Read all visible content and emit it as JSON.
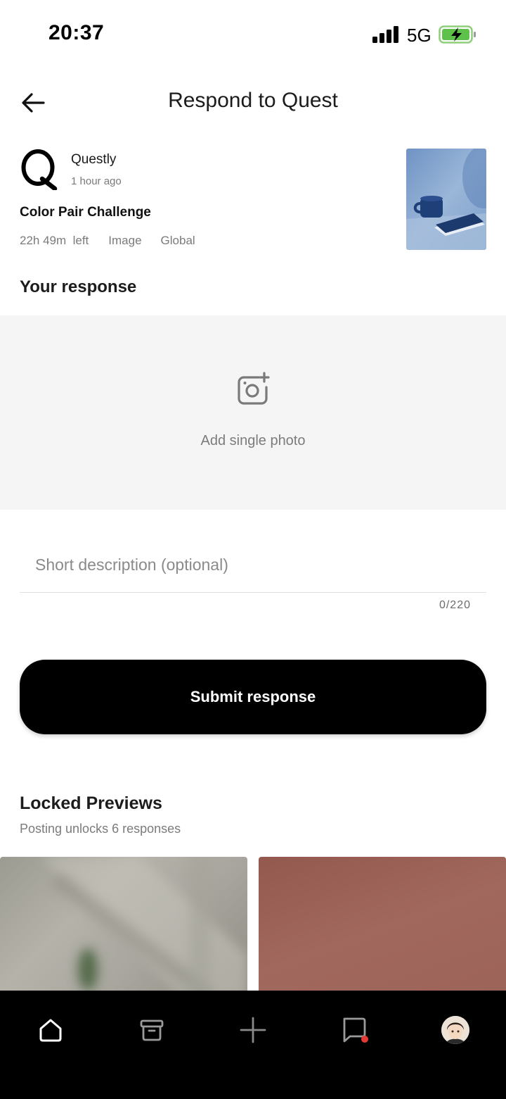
{
  "status_bar": {
    "time": "20:37",
    "network": "5G"
  },
  "header": {
    "title": "Respond to Quest"
  },
  "quest": {
    "author": "Questly",
    "time_ago": "1 hour ago",
    "title": "Color Pair Challenge",
    "time_left": "22h 49m  left",
    "type": "Image",
    "scope": "Global"
  },
  "response": {
    "section_title": "Your response",
    "upload_label": "Add single photo",
    "description_placeholder": "Short description (optional)",
    "description_value": "",
    "char_counter": "0/220",
    "submit_label": "Submit response"
  },
  "locked": {
    "title": "Locked Previews",
    "subtitle": "Posting unlocks 6 responses"
  },
  "tabbar": {
    "items": [
      "home-icon",
      "archive-icon",
      "plus-icon",
      "messages-icon",
      "avatar"
    ],
    "notification_dot_color": "#e53935"
  },
  "colors": {
    "primary": "#000000",
    "muted_text": "#7b7b7b",
    "upload_bg": "#f5f5f5"
  }
}
